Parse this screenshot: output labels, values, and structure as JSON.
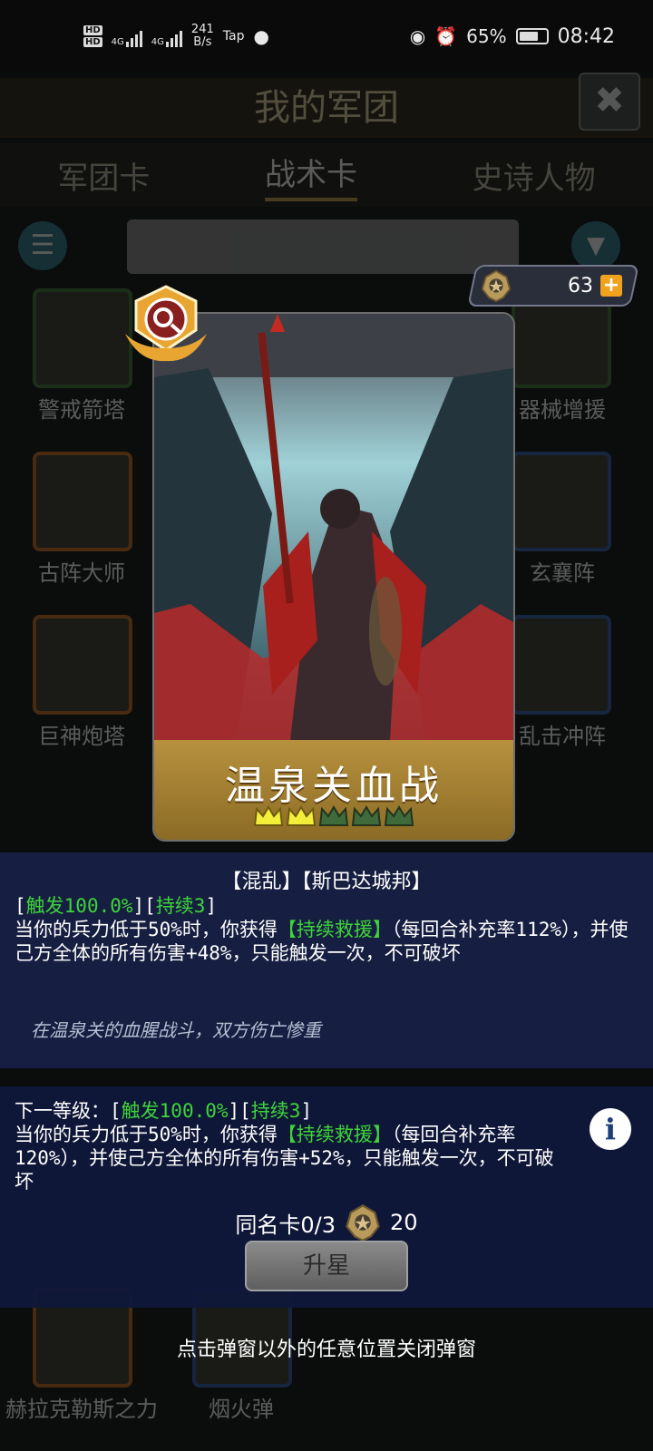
{
  "status_bar": {
    "network_speed_value": "241",
    "network_speed_unit": "B/s",
    "app_indicator": "Tap",
    "battery": "65%",
    "time": "08:42"
  },
  "background": {
    "title": "我的军团",
    "tabs": [
      "军团卡",
      "战术卡",
      "史诗人物"
    ],
    "active_tab": "战术卡",
    "card_labels": [
      "警戒箭塔",
      "器械增援",
      "古阵大师",
      "玄襄阵",
      "巨神炮塔",
      "乱击冲阵",
      "赫拉克勒斯之力",
      "烟火弹"
    ]
  },
  "currency": {
    "value": "63",
    "plus": "+"
  },
  "card": {
    "name": "温泉关血战",
    "stars_filled": 2,
    "stars_total": 5
  },
  "description": {
    "tags": "【混乱】【斯巴达城邦】",
    "trigger_prefix": "[",
    "trigger": "触发100.0%",
    "mid": "][",
    "duration": "持续3",
    "suffix": "]",
    "line1_a": "当你的兵力低于50%时，你获得",
    "effect": "【持续救援】",
    "line1_b": "（每回合补充率112%），并使己方全体的所有伤害+48%，只能触发一次，不可破坏",
    "flavor": "在温泉关的血腥战斗，双方伤亡惨重"
  },
  "next_level": {
    "label": "下一等级：[",
    "trigger": "触发100.0%",
    "mid": "][",
    "duration": "持续3",
    "suffix": "]",
    "text_a": "当你的兵力低于50%时，你获得",
    "effect": "【持续救援】",
    "text_b": "（每回合补充率120%），并使己方全体的所有伤害+52%，只能触发一次，不可破坏",
    "info": "i",
    "duplicate_label": "同名卡0/3",
    "duplicate_cost": "20",
    "upgrade_button": "升星"
  },
  "close_hint": "点击弹窗以外的任意位置关闭弹窗"
}
